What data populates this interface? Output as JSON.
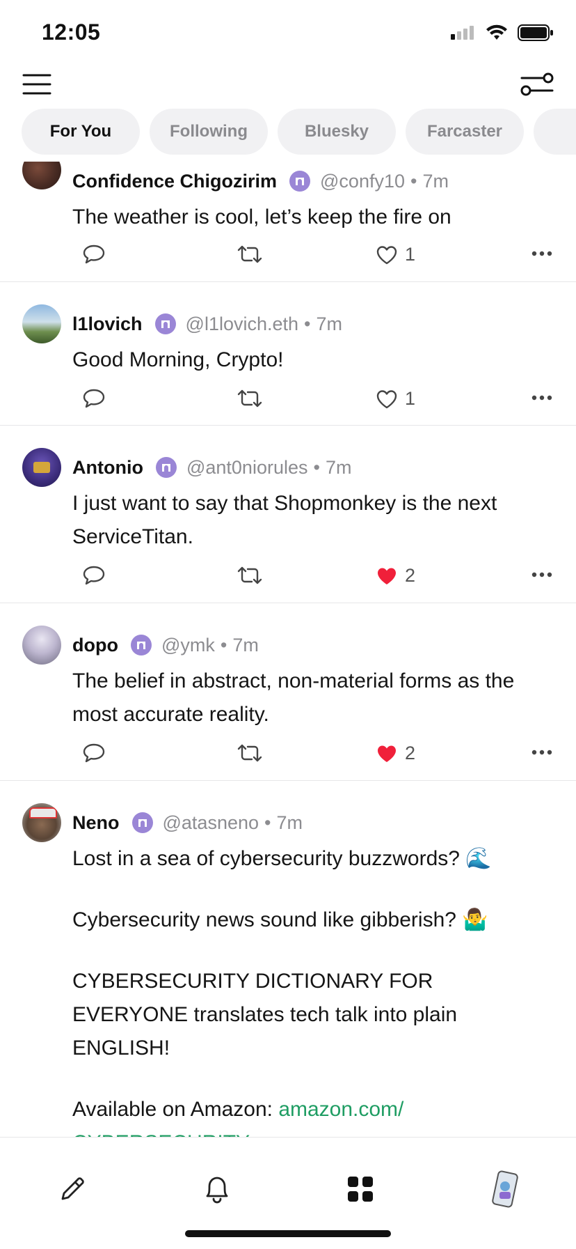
{
  "status_bar": {
    "time": "12:05"
  },
  "tabs": [
    {
      "label": "For You",
      "active": true
    },
    {
      "label": "Following",
      "active": false
    },
    {
      "label": "Bluesky",
      "active": false
    },
    {
      "label": "Farcaster",
      "active": false
    }
  ],
  "posts": [
    {
      "name": "Confidence Chigozirim",
      "handle": "@confy10",
      "time": "7m",
      "text": [
        "The weather is cool, let’s keep the fire on"
      ],
      "likes": "1",
      "liked": false
    },
    {
      "name": "l1lovich",
      "handle": "@l1lovich.eth",
      "time": "7m",
      "text": [
        "Good Morning, Crypto!"
      ],
      "likes": "1",
      "liked": false
    },
    {
      "name": "Antonio",
      "handle": "@ant0niorules",
      "time": "7m",
      "text": [
        "I just want to say that Shopmonkey is the next ServiceTitan."
      ],
      "likes": "2",
      "liked": true
    },
    {
      "name": "dopo",
      "handle": "@ymk",
      "time": "7m",
      "text": [
        "The belief in abstract, non-material forms as the most accurate reality."
      ],
      "likes": "2",
      "liked": true
    },
    {
      "name": "Neno",
      "handle": "@atasneno",
      "time": "7m",
      "paragraphs": [
        "Lost in a sea of cybersecurity buzzwords? 🌊",
        "Cybersecurity news sound like gibberish? 🤷‍♂️",
        "CYBERSECURITY DICTIONARY FOR EVERYONE translates tech talk into plain ENGLISH!",
        "Available on Amazon: "
      ],
      "link": "amazon.com/",
      "link_cont": "CYBERSECURITY"
    }
  ],
  "colors": {
    "accent_green": "#1f9d63",
    "badge_purple": "#9a86d6",
    "like_red": "#f0203a"
  }
}
